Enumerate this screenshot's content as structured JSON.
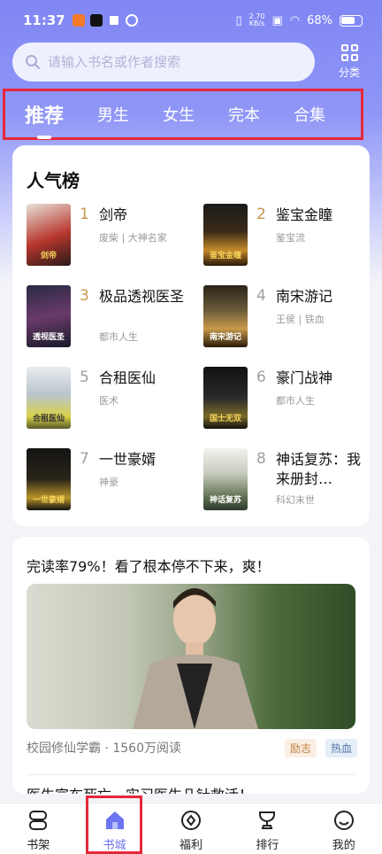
{
  "status_bar": {
    "time": "11:37",
    "net_speed_value": "2.70",
    "net_speed_unit": "KB/s",
    "battery": "68%"
  },
  "search": {
    "placeholder": "请输入书名或作者搜索"
  },
  "category_button": {
    "label": "分类"
  },
  "tabs": [
    {
      "label": "推荐",
      "active": true
    },
    {
      "label": "男生"
    },
    {
      "label": "女生"
    },
    {
      "label": "完本"
    },
    {
      "label": "合集"
    }
  ],
  "ranking": {
    "title": "人气榜",
    "books": [
      {
        "rank": "1",
        "name": "剑帝",
        "tags": "废柴 | 大神名家",
        "cover_text": "剑帝"
      },
      {
        "rank": "2",
        "name": "鉴宝金瞳",
        "tags": "鉴宝流",
        "cover_text": "鉴宝金瞳"
      },
      {
        "rank": "3",
        "name": "极品透视医圣",
        "tags": "都市人生",
        "cover_text": "透视医圣"
      },
      {
        "rank": "4",
        "name": "南宋游记",
        "tags": "王侯 | 铁血",
        "cover_text": "南宋游记"
      },
      {
        "rank": "5",
        "name": "合租医仙",
        "tags": "医术",
        "cover_text": "合租医仙"
      },
      {
        "rank": "6",
        "name": "豪门战神",
        "tags": "都市人生",
        "cover_text": "国士无双"
      },
      {
        "rank": "7",
        "name": "一世豪婿",
        "tags": "神豪",
        "cover_text": "一世豪婿"
      },
      {
        "rank": "8",
        "name": "神话复苏：我来册封…",
        "tags": "科幻末世",
        "cover_text": "神话复苏"
      }
    ]
  },
  "feed": {
    "title": "完读率79%！看了根本停不下来，爽！",
    "book_name": "校园修仙学霸",
    "reads": "1560万阅读",
    "chips": [
      "励志",
      "热血"
    ],
    "next_title": "医生宣布死亡，实习医生几针救活！"
  },
  "bottom_nav": [
    {
      "label": "书架"
    },
    {
      "label": "书城",
      "active": true
    },
    {
      "label": "福利"
    },
    {
      "label": "排行"
    },
    {
      "label": "我的"
    }
  ],
  "colors": {
    "accent": "#6d74ef",
    "highlight": "#e5283a",
    "rank_gold": "#c8954a"
  }
}
